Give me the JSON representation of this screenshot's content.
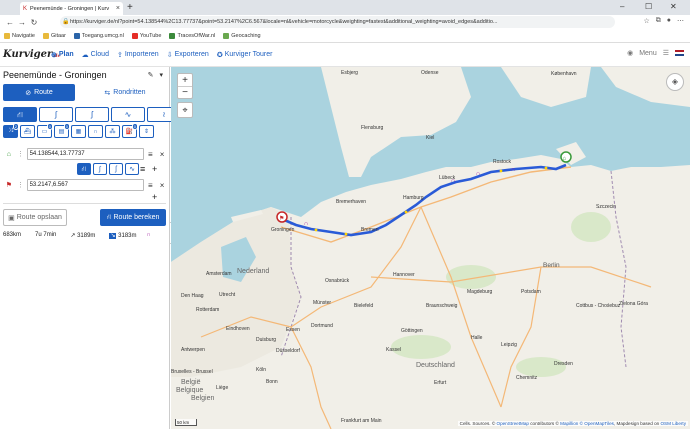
{
  "browser": {
    "tab_title": "Peenemünde - Groningen | Kurv",
    "url": "https://kurviger.de/nl?point=54.138544%2C13.77737&point=53.2147%2C6.567&locale=nl&vehicle=motorcycle&weighting=fastest&additional_weighting=avoid_edges&additio...",
    "bookmarks": [
      "Navigatie",
      "Gitaar",
      "Toegang.umcg.nl",
      "YouTube",
      "TracesOfWar.nl",
      "Geocaching"
    ]
  },
  "app": {
    "logo_text": "Kurviger",
    "logo_suffix": ".de",
    "nav": [
      "Plan",
      "Cloud",
      "Importeren",
      "Exporteren",
      "Kurviger Tourer"
    ],
    "menu_label": "Menu"
  },
  "sidebar": {
    "route_title": "Peenemünde - Groningen",
    "mode_route": "Route",
    "mode_rond": "Rondritten",
    "avoid_badges": [
      "2",
      "0",
      "0",
      "0"
    ],
    "start_value": "54.138544,13.77737",
    "end_value": "53.2147,6.567",
    "save_label": "Route opslaan",
    "calc_label": "Route bereken",
    "stats": {
      "distance": "683km",
      "duration": "7u 7min",
      "ascent": "3189m",
      "descent": "3183m"
    }
  },
  "map": {
    "labels": {
      "Esbjerg": "Esbjerg",
      "Odense": "Odense",
      "Kobenhavn": "København",
      "Flensburg": "Flensburg",
      "Kiel": "Kiel",
      "Lubeck": "Lübeck",
      "Rostock": "Rostock",
      "Bremerhaven": "Bremerhaven",
      "Hamburg": "Hamburg",
      "Bremen": "Bremen",
      "Groningen": "Groningen",
      "Szczecin": "Szczecin",
      "Hannover": "Hannover",
      "Berlin": "Berlin",
      "Osnabruck": "Osnabrück",
      "Magdeburg": "Magdeburg",
      "Nederland": "Nederland",
      "Amsterdam": "Amsterdam",
      "DenHaag": "Den Haag",
      "Utrecht": "Utrecht",
      "Rotterdam": "Rotterdam",
      "Munster": "Münster",
      "Potsdam": "Potsdam",
      "Bielefeld": "Bielefeld",
      "Braunschweig": "Braunschweig",
      "Eindhoven": "Eindhoven",
      "Dortmund": "Dortmund",
      "Essen": "Essen",
      "Duisburg": "Duisburg",
      "Dusseldorf": "Düsseldorf",
      "Kassel": "Kassel",
      "Gottingen": "Göttingen",
      "Halle": "Halle",
      "Leipzig": "Leipzig",
      "Cottbus": "Cottbus - Chośebuz",
      "ZielonaGora": "Zielona Góra",
      "Antwerpen": "Antwerpen",
      "Brussel": "Bruxelles - Brussel",
      "Belgie": "België",
      "Belgique": "Belgique",
      "Belgien": "Belgien",
      "Koln": "Köln",
      "Bonn": "Bonn",
      "Liege": "Liège",
      "Deutschland": "Deutschland",
      "Erfurt": "Erfurt",
      "Dresden": "Dresden",
      "Chemnitz": "Chemnitz",
      "Frankfurt": "Frankfurt am Main"
    },
    "scale": "50 km",
    "attribution_prefix": "Cells. Sources. ©",
    "attribution_osm": "OpenStreetMap",
    "attribution_mid": "contributors ©",
    "attribution_mapillion": "Mapillion",
    "attribution_omt": "© OpenMapTiles",
    "attribution_basedon": ", Mapdesign based on",
    "attribution_osmlib": "OSM Liberty"
  }
}
